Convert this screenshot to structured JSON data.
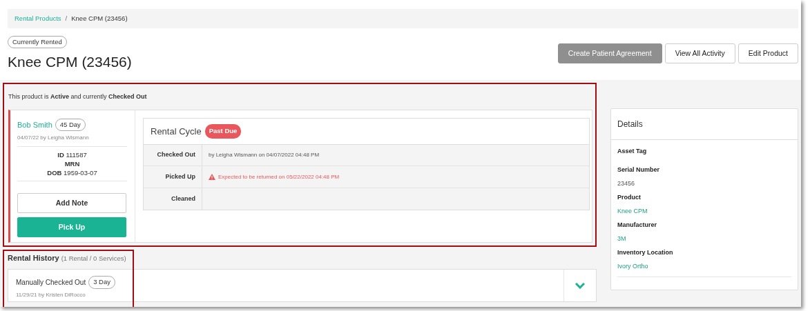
{
  "breadcrumb_separator": "/",
  "breadcrumb": [
    {
      "label": "Rental Products",
      "link": true
    },
    {
      "label": "Knee CPM (23456)",
      "link": false
    }
  ],
  "status_badge": "Currently Rented",
  "title": "Knee CPM (23456)",
  "actions": [
    {
      "label": "Create Patient Agreement",
      "disabled": true
    },
    {
      "label": "View All Activity",
      "disabled": false
    },
    {
      "label": "Edit Product",
      "disabled": false
    }
  ],
  "current": {
    "highlighted": true,
    "summary": "This product is **Active** and currently **Checked Out**",
    "renter": {
      "name": "Bob Smith",
      "duration": "45 Day",
      "meta": "04/07/22 by Leigha Wismann",
      "ids": [
        {
          "label": "ID",
          "value": "111587"
        },
        {
          "label": "MRN"
        },
        {
          "label": "DOB",
          "value": "1959-03-07"
        }
      ]
    },
    "buttons": [
      {
        "label": "Add Note",
        "kind": "outline"
      },
      {
        "label": "Pick Up",
        "kind": "primary"
      }
    ],
    "cycle": {
      "title": "Rental Cycle",
      "badge": "Past Due",
      "rows": [
        {
          "label": "Checked Out",
          "text": "by Leigha Wismann on 04/07/2022 04:48 PM",
          "warning": false
        },
        {
          "label": "Picked Up",
          "text": "Expected to be returned on 05/22/2022 04:48 PM",
          "warning": true
        },
        {
          "label": "Cleaned"
        }
      ]
    }
  },
  "history": {
    "title": "Rental History",
    "count": "(1 Rental / 0 Services)",
    "highlighted": true,
    "items": [
      {
        "title": "Manually Checked Out",
        "duration": "3 Day",
        "meta": "11/29/21 by Kristen DiRocco",
        "expanded": false
      }
    ]
  },
  "details": {
    "title": "Details",
    "fields": [
      {
        "label": "Asset Tag"
      },
      {
        "label": "Serial Number",
        "value": "23456",
        "link": false
      },
      {
        "label": "Product",
        "value": "Knee CPM",
        "link": true
      },
      {
        "label": "Manufacturer",
        "value": "3M",
        "link": true
      },
      {
        "label": "Inventory Location",
        "value": "Ivory Ortho",
        "link": true
      }
    ]
  }
}
